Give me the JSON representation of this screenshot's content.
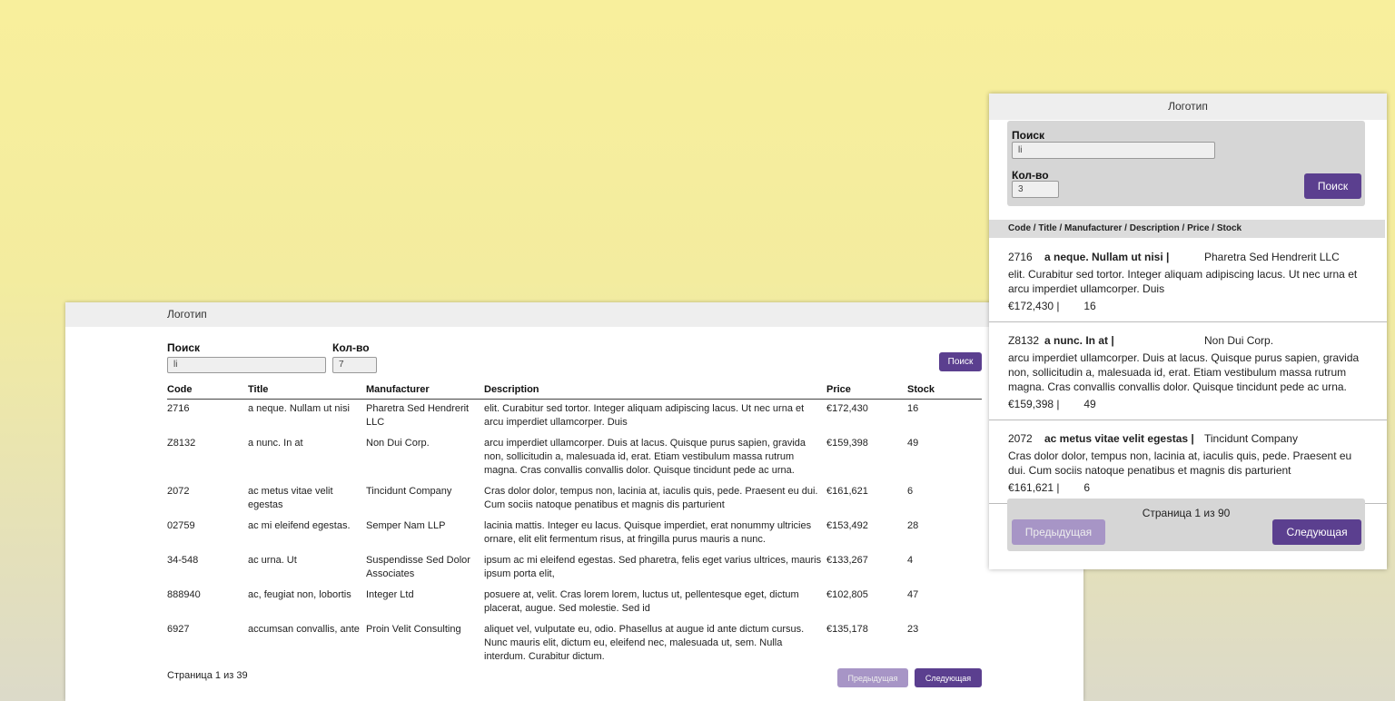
{
  "desktop": {
    "logo": "Логотип",
    "search_label": "Поиск",
    "search_value": "li",
    "count_label": "Кол-во",
    "count_value": "7",
    "search_button": "Поиск",
    "columns": [
      "Code",
      "Title",
      "Manufacturer",
      "Description",
      "Price",
      "Stock"
    ],
    "rows": [
      [
        "2716",
        "a neque. Nullam ut nisi",
        "Pharetra Sed Hendrerit LLC",
        "elit. Curabitur sed tortor. Integer aliquam adipiscing lacus. Ut nec urna et arcu imperdiet ullamcorper. Duis",
        "€172,430",
        "16"
      ],
      [
        "Z8132",
        "a nunc. In at",
        "Non Dui Corp.",
        "arcu imperdiet ullamcorper. Duis at lacus. Quisque purus sapien, gravida non, sollicitudin a, malesuada id, erat. Etiam vestibulum massa rutrum magna. Cras convallis convallis dolor. Quisque tincidunt pede ac urna.",
        "€159,398",
        "49"
      ],
      [
        "2072",
        "ac metus vitae velit egestas",
        "Tincidunt Company",
        "Cras dolor dolor, tempus non, lacinia at, iaculis quis, pede. Praesent eu dui. Cum sociis natoque penatibus et magnis dis parturient",
        "€161,621",
        "6"
      ],
      [
        "02759",
        "ac mi eleifend egestas.",
        "Semper Nam LLP",
        "lacinia mattis. Integer eu lacus. Quisque imperdiet, erat nonummy ultricies ornare, elit elit fermentum risus, at fringilla purus mauris a nunc.",
        "€153,492",
        "28"
      ],
      [
        "34-548",
        "ac urna. Ut",
        "Suspendisse Sed Dolor Associates",
        "ipsum ac mi eleifend egestas. Sed pharetra, felis eget varius ultrices, mauris ipsum porta elit,",
        "€133,267",
        "4"
      ],
      [
        "888940",
        "ac, feugiat non, lobortis",
        "Integer Ltd",
        "posuere at, velit. Cras lorem lorem, luctus ut, pellentesque eget, dictum placerat, augue. Sed molestie. Sed id",
        "€102,805",
        "47"
      ],
      [
        "6927",
        "accumsan convallis, ante",
        "Proin Velit Consulting",
        "aliquet vel, vulputate eu, odio. Phasellus at augue id ante dictum cursus. Nunc mauris elit, dictum eu, eleifend nec, malesuada ut, sem. Nulla interdum. Curabitur dictum.",
        "€135,178",
        "23"
      ]
    ],
    "page_info": "Страница 1 из 39",
    "prev_button": "Предыдущая",
    "next_button": "Следующая"
  },
  "mobile": {
    "logo": "Логотип",
    "search_label": "Поиск",
    "search_value": "li",
    "count_label": "Кол-во",
    "count_value": "3",
    "search_button": "Поиск",
    "columns_header": "Code / Title / Manufacturer / Description / Price / Stock",
    "items": [
      {
        "code": "2716",
        "title": "a neque. Nullam ut nisi |",
        "manufacturer": "Pharetra Sed Hendrerit LLC",
        "description": "elit. Curabitur sed tortor. Integer aliquam adipiscing lacus. Ut nec urna et arcu imperdiet ullamcorper. Duis",
        "price": "€172,430 |",
        "stock": "16"
      },
      {
        "code": "Z8132",
        "title": "a nunc. In at |",
        "manufacturer": "Non Dui Corp.",
        "description": "arcu imperdiet ullamcorper. Duis at lacus. Quisque purus sapien, gravida non, sollicitudin a, malesuada id, erat. Etiam vestibulum massa rutrum magna. Cras convallis convallis dolor. Quisque tincidunt pede ac urna.",
        "price": "€159,398 |",
        "stock": "49"
      },
      {
        "code": "2072",
        "title": "ac metus vitae velit egestas |",
        "manufacturer": "Tincidunt Company",
        "description": "Cras dolor dolor, tempus non, lacinia at, iaculis quis, pede. Praesent eu dui. Cum sociis natoque penatibus et magnis dis parturient",
        "price": "€161,621 |",
        "stock": "6"
      }
    ],
    "page_info": "Страница 1 из 90",
    "prev_button": "Предыдущая",
    "next_button": "Следующая"
  }
}
